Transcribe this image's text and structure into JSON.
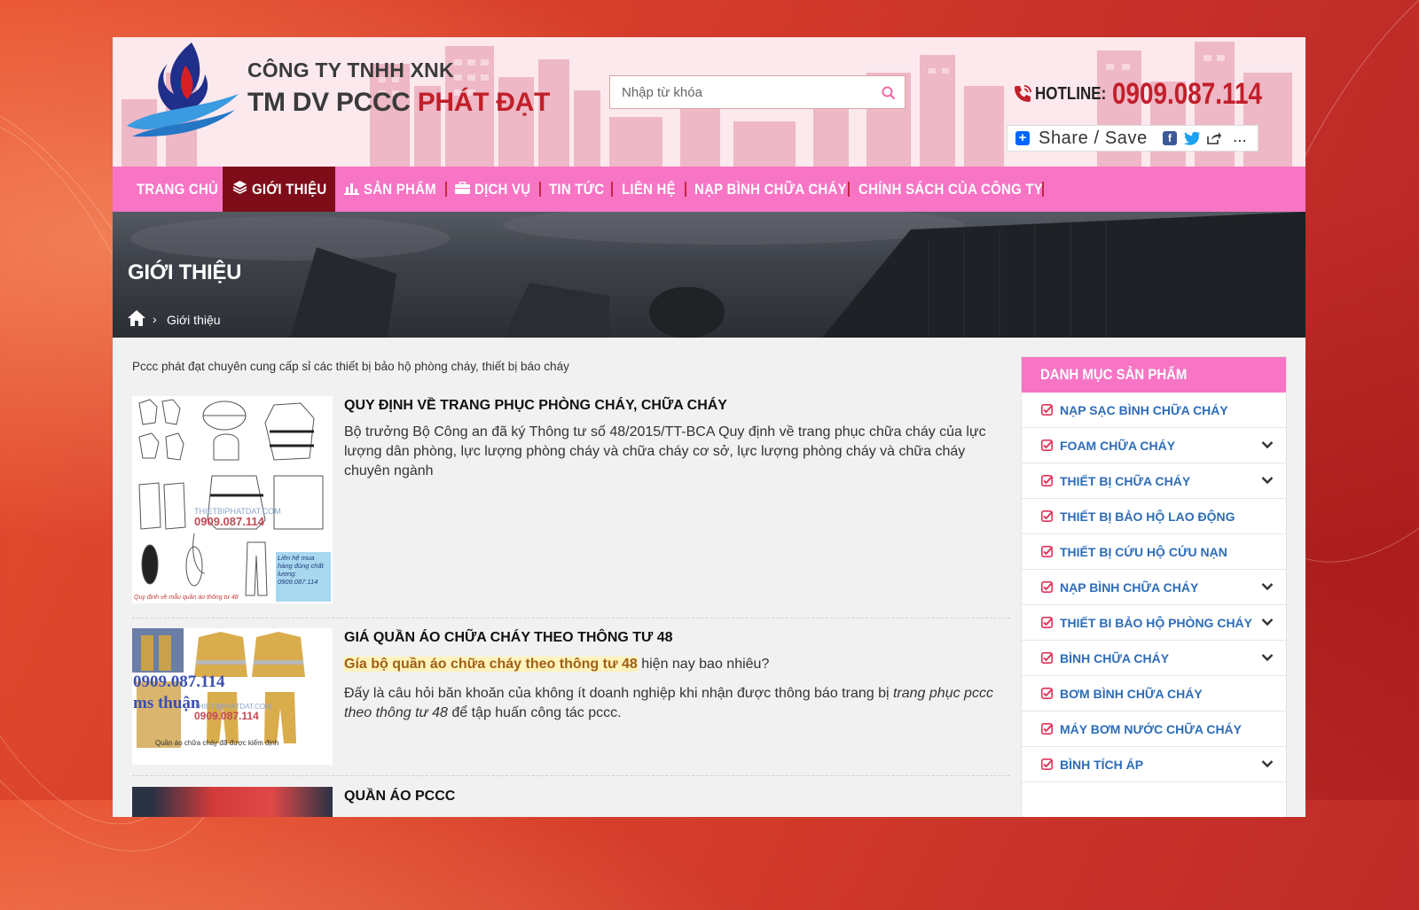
{
  "header": {
    "company_line1": "CÔNG TY TNHH XNK",
    "company_line2_prefix": "TM DV PCCC",
    "company_line2_accent": "PHÁT ĐẠT",
    "search_placeholder": "Nhập từ khóa",
    "hotline_label": "HOTLINE:",
    "hotline_number": "0909.087.114",
    "share_label": "Share / Save",
    "share_more": "..."
  },
  "nav": {
    "items": [
      {
        "label": "TRANG CHỦ"
      },
      {
        "label": "GIỚI THIỆU",
        "active": true
      },
      {
        "label": "SẢN PHẨM"
      },
      {
        "label": "DỊCH VỤ"
      },
      {
        "label": "TIN TỨC"
      },
      {
        "label": "LIÊN HỆ"
      },
      {
        "label": "NẠP BÌNH CHỮA CHÁY"
      },
      {
        "label": "CHÍNH SÁCH CỦA CÔNG TY"
      }
    ]
  },
  "banner": {
    "title": "GIỚI THIỆU",
    "breadcrumb_current": "Giới thiệu"
  },
  "content": {
    "intro": "Pccc phát đạt chuyên cung cấp sỉ các thiết bị bảo hộ phòng cháy, thiết bị báo cháy",
    "posts": [
      {
        "title": "QUY ĐỊNH VỀ TRANG PHỤC PHÒNG CHÁY, CHỮA CHÁY",
        "excerpt": "Bộ trưởng Bộ Công an đã ký Thông tư số 48/2015/TT-BCA Quy định về trang phục chữa cháy của lực lượng dân phòng, lực lượng phòng cháy và chữa cháy cơ sở, lực lượng phòng cháy và chữa cháy chuyên ngành",
        "thumb_watermark": "THIETBIPHATDAT.COM",
        "thumb_phone": "0909.087.114",
        "thumb_note": "Liên hệ mua hàng đúng chất lượng: 0909.087.114",
        "thumb_caption": "Quy định về mẫu quần áo thông tư 48"
      },
      {
        "title": "GIÁ QUẦN ÁO CHỮA CHÁY THEO THÔNG TƯ 48",
        "highlight": "Gía bộ quần áo chữa cháy theo thông tư 48",
        "excerpt_after_highlight": " hiện nay bao nhiêu?",
        "excerpt2_a": "Đấy là câu hỏi băn khoăn của không ít doanh nghiệp khi nhận được thông báo trang bị ",
        "excerpt2_italic": "trang phục pccc theo thông tư 48",
        "excerpt2_b": " để tập huấn công tác pccc.",
        "thumb_phone": "0909.087.114",
        "thumb_name": "ms thuận",
        "thumb_watermark": "THIETBIPHATDAT.COM",
        "thumb_phone2": "0909.087.114",
        "thumb_caption": "Quần áo chữa cháy đã được kiểm định"
      },
      {
        "title": "QUẦN ÁO PCCC"
      }
    ]
  },
  "sidebar": {
    "title": "DANH MỤC SẢN PHẨM",
    "items": [
      {
        "label": "NẠP SẠC BÌNH CHỮA CHÁY",
        "has_children": false
      },
      {
        "label": "FOAM CHỮA CHÁY",
        "has_children": true
      },
      {
        "label": "THIẾT BỊ CHỮA CHÁY",
        "has_children": true
      },
      {
        "label": "THIẾT BỊ BẢO HỘ LAO ĐỘNG",
        "has_children": false
      },
      {
        "label": "THIẾT BỊ CỨU HỘ CỨU NẠN",
        "has_children": false
      },
      {
        "label": "NẠP BÌNH CHỮA CHÁY",
        "has_children": true
      },
      {
        "label": "THIẾT BI BẢO HỘ PHÒNG CHÁY",
        "has_children": true
      },
      {
        "label": "BÌNH CHỮA CHÁY",
        "has_children": true
      },
      {
        "label": "BƠM BÌNH CHỮA CHÁY",
        "has_children": false
      },
      {
        "label": "MÁY BƠM NƯỚC CHỮA CHÁY",
        "has_children": false
      },
      {
        "label": "BÌNH TÍCH ÁP",
        "has_children": true
      }
    ]
  },
  "colors": {
    "nav_pink": "#f775c4",
    "nav_active": "#7e0c19",
    "brand_red": "#c11f2a",
    "sidebar_link": "#2d6cb8"
  }
}
